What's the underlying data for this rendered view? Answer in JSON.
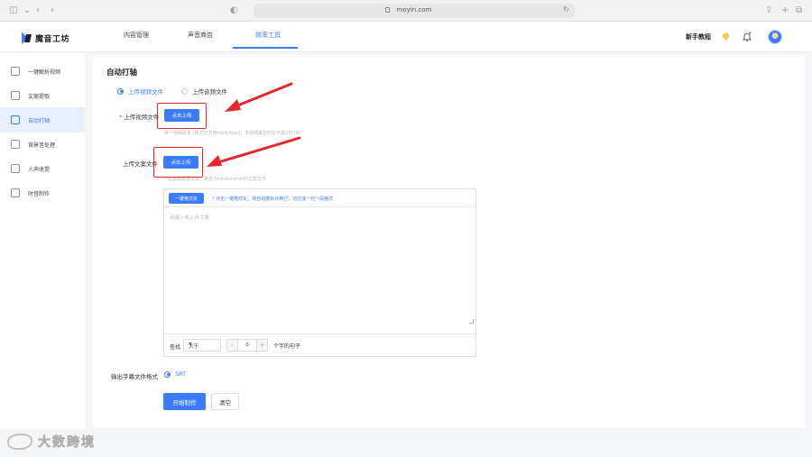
{
  "browser": {
    "url": "moyin.com",
    "icons": [
      "sidebar-icon",
      "back-icon",
      "forward-icon",
      "shield-icon",
      "lock-icon",
      "reload-icon",
      "share-icon",
      "add-tab-icon",
      "tabs-icon"
    ]
  },
  "header": {
    "brand": "魔音工坊",
    "tabs": [
      {
        "label": "内容管理"
      },
      {
        "label": "声音商店"
      },
      {
        "label": "效率工具",
        "active": true
      }
    ],
    "help": "新手教程",
    "icons": [
      "gem-icon",
      "bell-icon",
      "avatar"
    ]
  },
  "sidebar": {
    "items": [
      {
        "label": "一键解析视频",
        "icon": "video-icon"
      },
      {
        "label": "文案提取",
        "icon": "text-icon"
      },
      {
        "label": "自动打轴",
        "icon": "timeline-icon",
        "active": true
      },
      {
        "label": "背景音处理",
        "icon": "music-icon"
      },
      {
        "label": "人声收提",
        "icon": "voice-icon"
      },
      {
        "label": "时音制作",
        "icon": "clip-icon"
      }
    ]
  },
  "main": {
    "title": "自动打轴",
    "source_options": [
      {
        "label": "上传视频文件",
        "selected": true
      },
      {
        "label": "上传音频文件",
        "selected": false
      }
    ],
    "video_upload": {
      "label": "上传视频文件",
      "required": true,
      "button": "点击上传",
      "hint": "单个视频最多 (格式仅支持mp4/mov)，单视频最长时长不超15分钟"
    },
    "text_upload": {
      "label": "上传文案文件",
      "button": "点击上传",
      "hint": "一段剪辑需要文案，格式为txt/docx/srt的文案文件"
    },
    "editor": {
      "format_button": "一键格式化",
      "format_hint": "* 点击一键格式化，将自动按标点换行，切分成一句一段格式",
      "placeholder": "请输入或上传文案",
      "search_label": "查找",
      "select_value": "大于",
      "stepper_value": "0",
      "stepper_minus": "-",
      "stepper_plus": "+",
      "unit": "个字的句子"
    },
    "output": {
      "label": "输出字幕文件格式",
      "format": "SRT"
    },
    "actions": {
      "start": "开始制作",
      "clear": "清空"
    }
  },
  "annotations": {
    "highlight_color": "#e5262b"
  },
  "watermark": {
    "text": "大数跨境"
  },
  "colors": {
    "accent": "#3b7cff",
    "annotation_red": "#e5262b"
  }
}
